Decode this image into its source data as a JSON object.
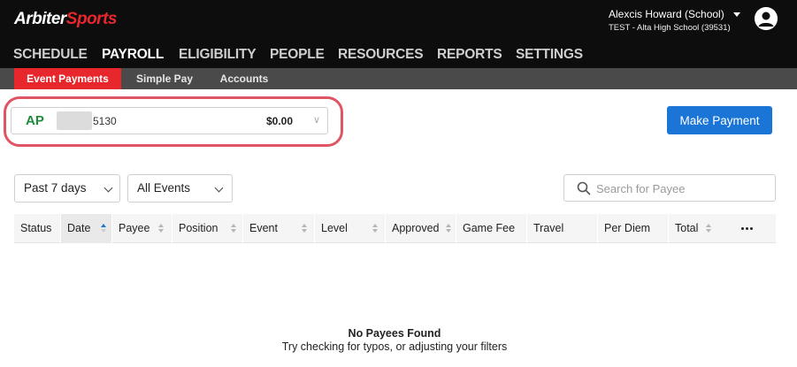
{
  "brand": {
    "part1": "Arbiter",
    "part2": "Sports",
    "accent": "#e8272c"
  },
  "user": {
    "name": "Alexcis Howard (School)",
    "school": "TEST - Alta High School (39531)"
  },
  "main_nav": [
    "SCHEDULE",
    "PAYROLL",
    "ELIGIBILITY",
    "PEOPLE",
    "RESOURCES",
    "REPORTS",
    "SETTINGS"
  ],
  "main_nav_active": "PAYROLL",
  "sub_nav": [
    "Event Payments",
    "Simple Pay",
    "Accounts"
  ],
  "sub_nav_active": "Event Payments",
  "account": {
    "type": "AP",
    "number_suffix": "5130",
    "balance": "$0.00"
  },
  "make_payment_label": "Make Payment",
  "filters": {
    "date_range": "Past 7 days",
    "events": "All Events"
  },
  "search": {
    "placeholder": "Search for Payee",
    "value": ""
  },
  "table": {
    "columns": [
      "Status",
      "Date",
      "Payee",
      "Position",
      "Event",
      "Level",
      "Approved",
      "Game Fee",
      "Travel",
      "Per Diem",
      "Total"
    ],
    "sorted_column": "Date",
    "rows": []
  },
  "empty_state": {
    "title": "No Payees Found",
    "subtitle": "Try checking for typos, or adjusting your filters"
  }
}
